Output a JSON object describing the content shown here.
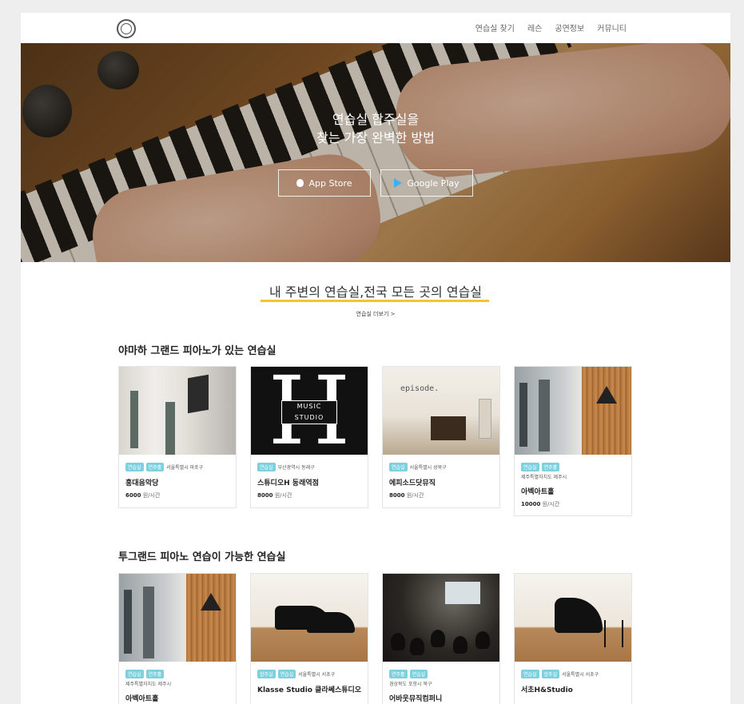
{
  "nav": {
    "links": [
      "연습실 찾기",
      "레슨",
      "공연정보",
      "커뮤니티"
    ]
  },
  "hero": {
    "title_line1": "연습실 합주실을",
    "title_line2": "찾는 가장 완벽한 방법",
    "app_store": "App Store",
    "google_play": "Google Play"
  },
  "section": {
    "title": "내 주변의 연습실,전국 모든 곳의 연습실",
    "more": "연습실 더보기 >"
  },
  "groups": [
    {
      "title": "야마하 그랜드 피아노가 있는 연습실",
      "cards": [
        {
          "tags": [
            "연습실",
            "연주홀"
          ],
          "region": "서울특별시 마포구",
          "name": "홍대음악당",
          "price": "6000",
          "unit": " 원/시간"
        },
        {
          "tags": [
            "연습실"
          ],
          "region": "부산광역시 동래구",
          "name": "스튜디오H 동래역점",
          "price": "8000",
          "unit": " 원/시간"
        },
        {
          "tags": [
            "연습실"
          ],
          "region": "서울특별시 성북구",
          "name": "에피소드닷뮤직",
          "price": "8000",
          "unit": " 원/시간"
        },
        {
          "tags": [
            "연습실",
            "연주홀"
          ],
          "region": "제주특별자치도 제주시",
          "name": "아벡아트홀",
          "price": "10000",
          "unit": " 원/시간"
        }
      ]
    },
    {
      "title": "투그랜드 피아노 연습이 가능한 연습실",
      "cards": [
        {
          "tags": [
            "연습실",
            "연주홀"
          ],
          "region": "제주특별자치도 제주시",
          "name": "아벡아트홀",
          "price": "",
          "unit": ""
        },
        {
          "tags": [
            "합주실",
            "연습실"
          ],
          "region": "서울특별시 서초구",
          "name": "Klasse Studio 클라쎄스튜디오",
          "price": "",
          "unit": ""
        },
        {
          "tags": [
            "연주홀",
            "연습실"
          ],
          "region": "경상북도 포항시 북구",
          "name": "어바웃뮤직컴퍼니",
          "price": "",
          "unit": ""
        },
        {
          "tags": [
            "연습실",
            "합주실"
          ],
          "region": "서울특별시 서초구",
          "name": "서초H&Studio",
          "price": "",
          "unit": ""
        }
      ]
    }
  ],
  "colors": {
    "accent_underline": "#f6c42f",
    "tag_bg": "#7fd0df"
  }
}
